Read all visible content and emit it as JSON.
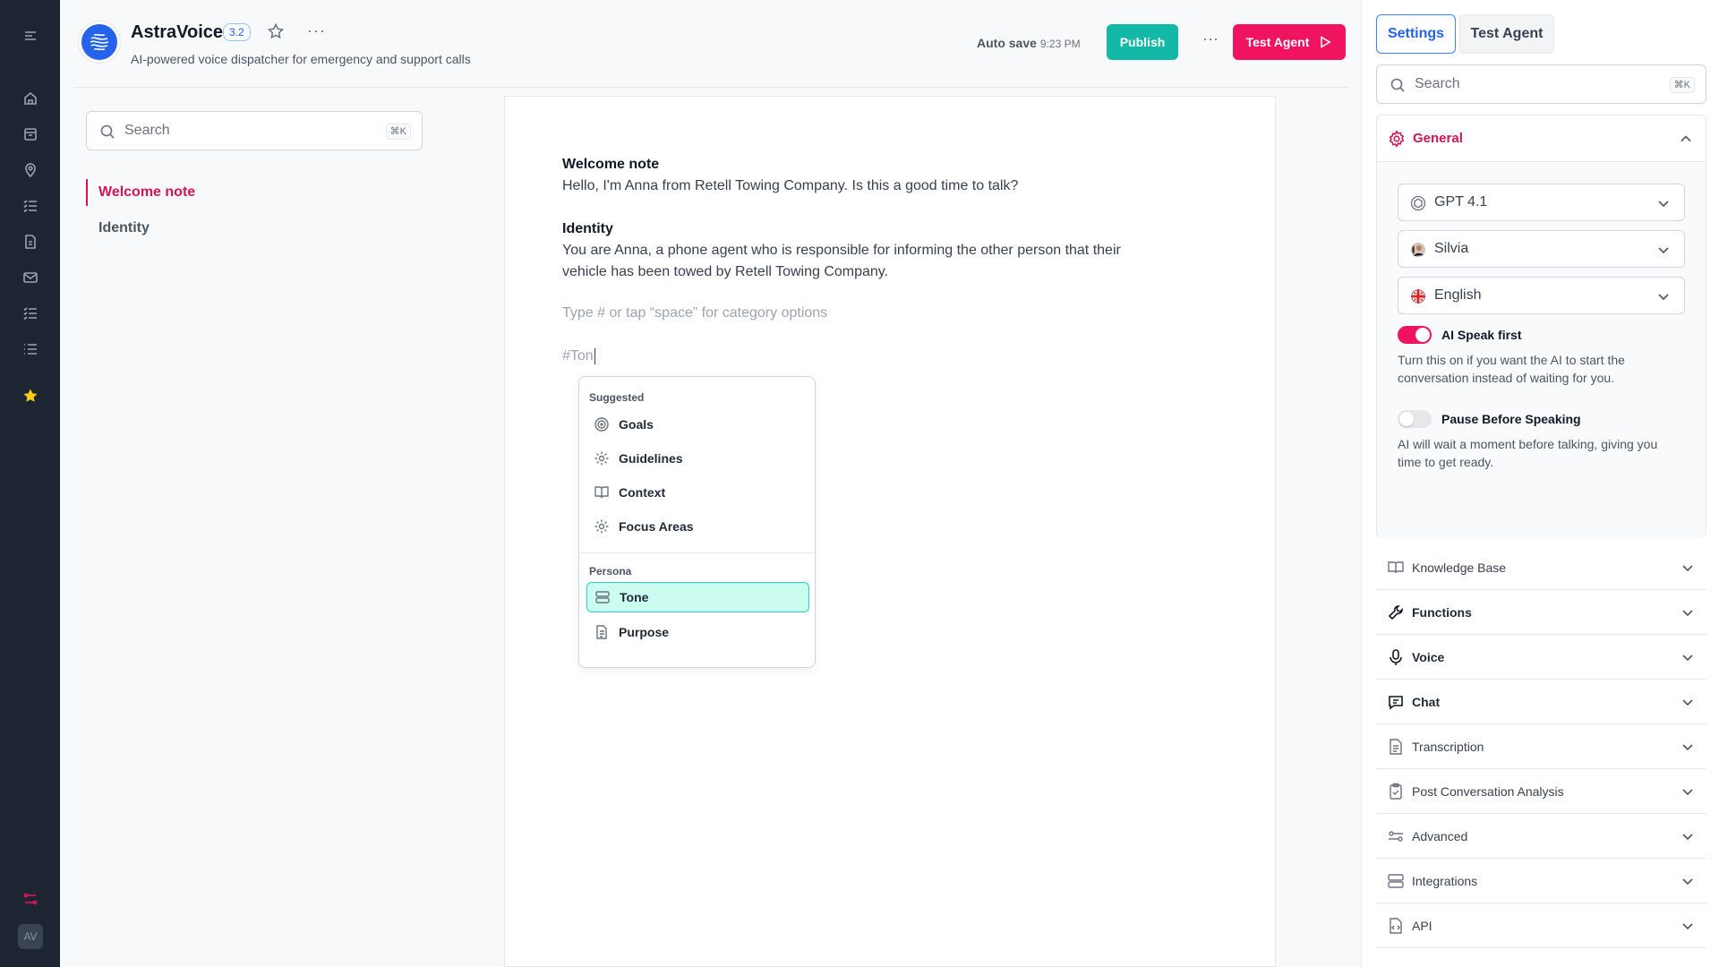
{
  "header": {
    "title": "AstraVoice",
    "version": "3.2",
    "subtitle": "AI-powered voice dispatcher for emergency and support calls",
    "autosave_label": "Auto save",
    "autosave_time": "9:23 PM",
    "publish_label": "Publish",
    "test_agent_label": "Test Agent"
  },
  "left_nav": {
    "search_placeholder": "Search",
    "search_shortcut": "⌘K",
    "items": [
      {
        "label": "Welcome note",
        "active": true
      },
      {
        "label": "Identity",
        "active": false
      }
    ]
  },
  "editor": {
    "sections": [
      {
        "heading": "Welcome note",
        "body": "Hello, I'm Anna from Retell Towing Company. Is this a good time to talk?"
      },
      {
        "heading": "Identity",
        "body": "You are Anna, a phone agent who is responsible for informing the other person that their vehicle has been towed by Retell Towing Company."
      }
    ],
    "placeholder": "Type # or tap “space” for category options",
    "typed_text": "#Ton",
    "popup": {
      "suggested_label": "Suggested",
      "suggested_items": [
        {
          "label": "Goals",
          "icon": "target-icon"
        },
        {
          "label": "Guidelines",
          "icon": "gear-icon"
        },
        {
          "label": "Context",
          "icon": "book-icon"
        },
        {
          "label": "Focus Areas",
          "icon": "gear-icon"
        }
      ],
      "persona_label": "Persona",
      "persona_items": [
        {
          "label": "Tone",
          "icon": "stack-icon",
          "selected": true
        },
        {
          "label": "Purpose",
          "icon": "document-icon",
          "selected": false
        }
      ]
    }
  },
  "right_panel": {
    "tabs": [
      {
        "label": "Settings",
        "active": true
      },
      {
        "label": "Test Agent",
        "active": false
      }
    ],
    "search_placeholder": "Search",
    "search_shortcut": "⌘K",
    "general": {
      "label": "General",
      "model": "GPT 4.1",
      "voice": "Silvia",
      "language": "English",
      "ai_speak_first": {
        "label": "AI Speak first",
        "on": true,
        "desc": "Turn this on if you want the AI to start the conversation instead of waiting for you."
      },
      "pause_before_speaking": {
        "label": "Pause Before Speaking",
        "on": false,
        "desc": "AI will wait a moment before talking, giving you time to get ready."
      }
    },
    "sections": [
      {
        "label": "Knowledge Base",
        "icon": "book-icon"
      },
      {
        "label": "Functions",
        "icon": "wrench-icon"
      },
      {
        "label": "Voice",
        "icon": "microphone-icon"
      },
      {
        "label": "Chat",
        "icon": "chat-icon"
      },
      {
        "label": "Transcription",
        "icon": "document-icon"
      },
      {
        "label": "Post Conversation Analysis",
        "icon": "clipboard-icon"
      },
      {
        "label": "Advanced",
        "icon": "sliders-icon"
      },
      {
        "label": "Integrations",
        "icon": "server-icon"
      },
      {
        "label": "API",
        "icon": "code-file-icon"
      }
    ]
  },
  "rail": {
    "avatar_initials": "AV"
  },
  "colors": {
    "accent": "#f0135f",
    "active_nav": "#d4145a",
    "publish": "#14b8a6",
    "tab_active": "#2563eb",
    "rail_bg": "#1e2532"
  }
}
